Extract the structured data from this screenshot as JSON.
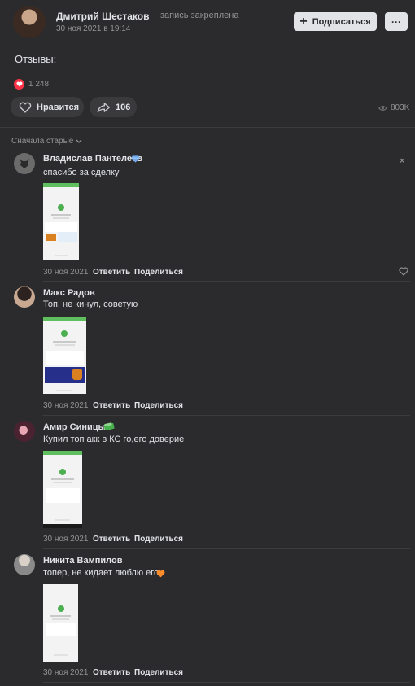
{
  "post": {
    "author": "Дмитрий Шестаков",
    "pinned_note": "запись закреплена",
    "date": "30 ноя 2021 в 19:14",
    "subscribe_label": "Подписаться",
    "more_label": "···",
    "text": "Отзывы:",
    "reactions_count": "1 248",
    "like_label": "Нравится",
    "share_count": "106",
    "views": "803K"
  },
  "comments_sort": "Сначала старые",
  "comments": [
    {
      "author": "Владислав Пантелеев",
      "text": "спасибо за сделку",
      "date": "30 ноя 2021",
      "reply": "Ответить",
      "share": "Поделиться"
    },
    {
      "author": "Макс Радов",
      "text": "Топ, не кинул, советую",
      "date": "30 ноя 2021",
      "reply": "Ответить",
      "share": "Поделиться"
    },
    {
      "author": "Амир Синицын",
      "text": "Купил топ акк в КС го,его доверие",
      "date": "30 ноя 2021",
      "reply": "Ответить",
      "share": "Поделиться"
    },
    {
      "author": "Никита Вампилов",
      "text": "топер, не кидает люблю его",
      "date": "30 ноя 2021",
      "reply": "Ответить",
      "share": "Поделиться"
    }
  ],
  "colors": {
    "background": "#2b2b2e",
    "button": "#3a3a3d",
    "accent_green": "#4caf50",
    "heart": "#ff3347",
    "badge_blue": "#71aaeb"
  }
}
